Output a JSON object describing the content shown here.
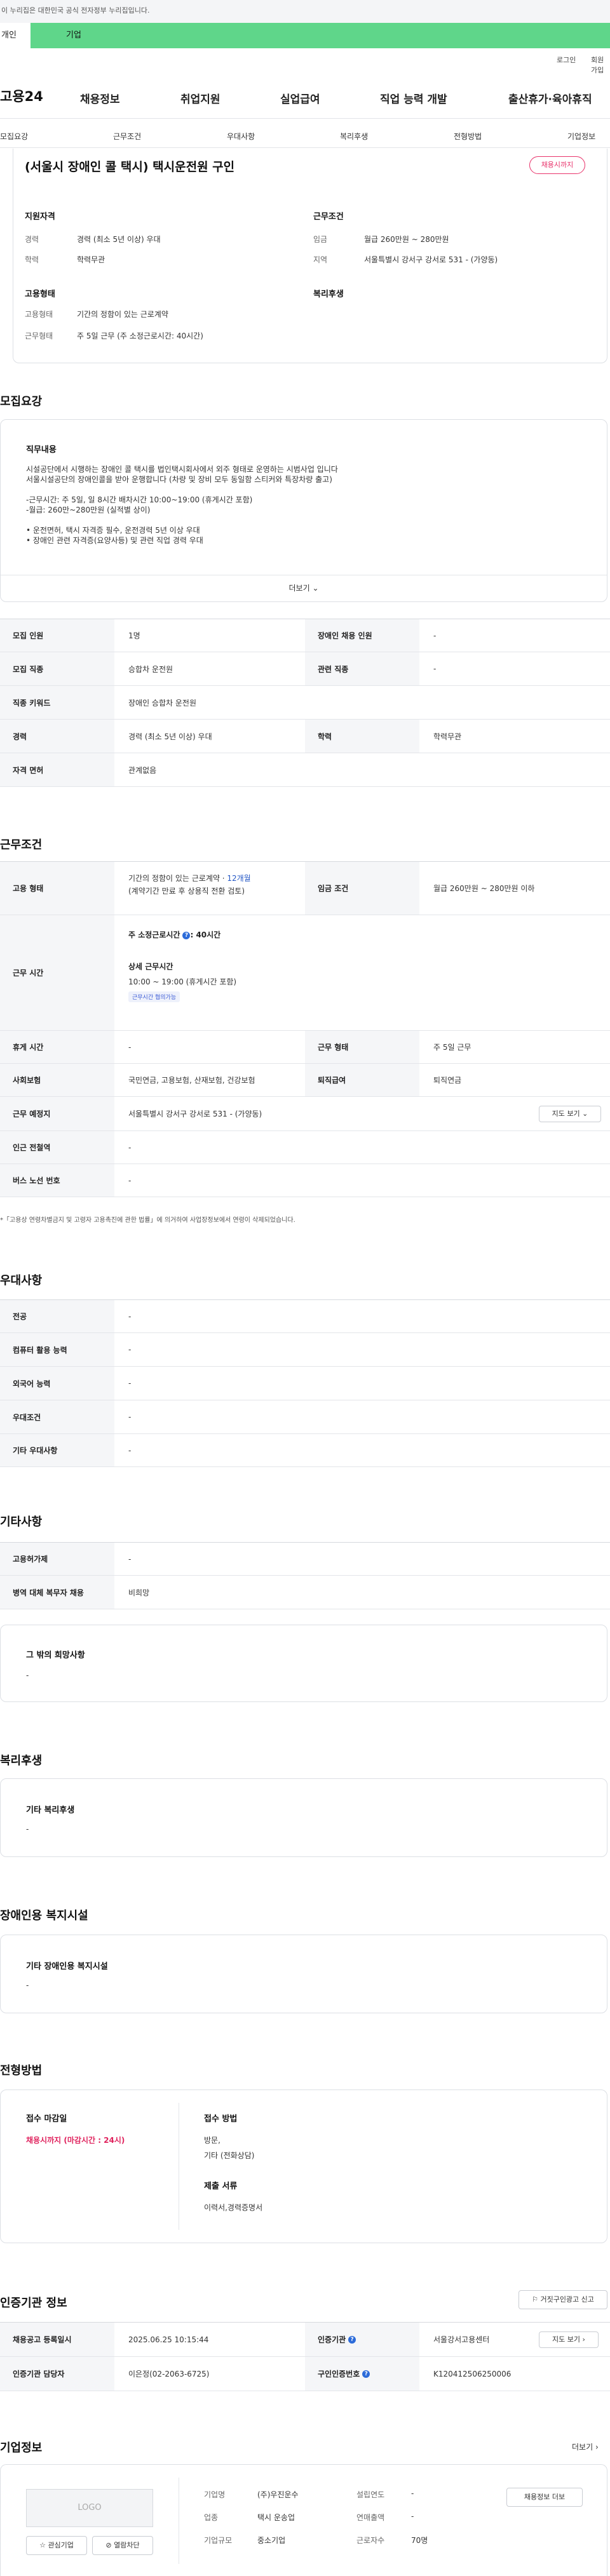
{
  "gov_banner": "이 누리집은 대한민국 공식 전자정부 누리집입니다.",
  "tabs": {
    "personal": "개인",
    "company": "기업"
  },
  "util": {
    "login": "로그인",
    "signup": "회원가입"
  },
  "logo": "고용24",
  "gnb": [
    "채용정보",
    "취업지원",
    "실업급여",
    "직업 능력 개발",
    "출산휴가·육아휴직"
  ],
  "subnav": [
    "모집요강",
    "근무조건",
    "우대사항",
    "복리후생",
    "전형방법",
    "기업정보"
  ],
  "summary": {
    "title": "(서울시 장애인 콜 택시) 택시운전원 구인",
    "badge": "채용시까지",
    "qual_title": "지원자격",
    "career_label": "경력",
    "career_value": "경력 (최소 5년 이상) 우대",
    "edu_label": "학력",
    "edu_value": "학력무관",
    "cond_title": "근무조건",
    "wage_label": "임금",
    "wage_value": "월급 260만원 ~ 280만원",
    "region_label": "지역",
    "region_value": "서울특별시 강서구 강서로 531 - (가양동)",
    "emp_title": "고용형태",
    "emp_type_label": "고용형태",
    "emp_type_value": "기간의 정함이 있는 근로계약",
    "work_label": "근무형태",
    "work_value": "주 5일 근무 (주 소정근로시간: 40시간)",
    "welfare_title": "복리후생"
  },
  "recruit": {
    "title": "모집요강",
    "duty_title": "직무내용",
    "duty_lines": [
      "시설공단에서 시행하는 장애인 콜 택시를 법인택시회사에서 외주 형태로 운영하는 시범사업 입니다",
      "서울시설공단의 장애인콜을 받아 운행합니다 (차량 및 장비 모두 동일함 스티커와 특장차량 출고)",
      "",
      "-근무시간: 주 5일, 일 8시간 배차시간 10:00~19:00 (휴게시간 포함)",
      "-월급: 260만~280만원 (실적별 상이)",
      "",
      "• 운전면허, 택시 자격증 필수, 운전경력 5년 이상 우대",
      "• 장애인 관련 자격증(요양사등) 및 관련 직업 경력 우대"
    ],
    "more": "더보기",
    "rows": [
      {
        "l1": "모집 인원",
        "v1": "1명",
        "l2": "장애인 채용 인원",
        "v2": "-"
      },
      {
        "l1": "모집 직종",
        "v1": "승합차 운전원",
        "l2": "관련 직종",
        "v2": "-"
      },
      {
        "l1": "직종 키워드",
        "v1": "장애인 승합차 운전원"
      },
      {
        "l1": "경력",
        "v1": "경력 (최소 5년 이상) 우대",
        "l2": "학력",
        "v2": "학력무관"
      },
      {
        "l1": "자격 면허",
        "v1": "관계없음"
      }
    ]
  },
  "conditions": {
    "title": "근무조건",
    "emp_label": "고용 형태",
    "emp_line1": "기간의 정함이 있는 근로계약 · ",
    "emp_months": "12개월",
    "emp_line2": "(계약기간 만료 후 상용직 전환 검토)",
    "wage_label": "임금 조건",
    "wage_value": "월급 260만원 ~ 280만원 이하",
    "hours_label": "근무 시간",
    "hours_main": "주 소정근로시간",
    "hours_num": ": 40시간",
    "detail_title": "상세 근무시간",
    "detail_value": "10:00 ~ 19:00 (휴게시간 포함)",
    "chip": "근무시간 협의가능",
    "rest_label": "휴게 시간",
    "rest_value": "-",
    "shift_label": "근무 형태",
    "shift_value": "주 5일 근무",
    "ins_label": "사회보험",
    "ins_value": "국민연금, 고용보험, 산재보험, 건강보험",
    "sev_label": "퇴직급여",
    "sev_value": "퇴직연금",
    "place_label": "근무 예정지",
    "place_value": "서울특별시 강서구 강서로 531 - (가양동)",
    "map_btn": "지도 보기",
    "station_label": "인근 전철역",
    "station_value": "-",
    "bus_label": "버스 노선 번호",
    "bus_value": "-",
    "note": "*「고용상 연령차별금지 및 고령자 고용촉진에 관한 법률」에 의거하여 사업장정보에서 연령이 삭제되었습니다."
  },
  "pref": {
    "title": "우대사항",
    "rows": [
      {
        "l": "전공",
        "v": "-"
      },
      {
        "l": "컴퓨터 활용 능력",
        "v": "-"
      },
      {
        "l": "외국어 능력",
        "v": "-"
      },
      {
        "l": "우대조건",
        "v": "-"
      },
      {
        "l": "기타 우대사항",
        "v": "-"
      }
    ]
  },
  "other": {
    "title": "기타사항",
    "rows": [
      {
        "l": "고용허가제",
        "v": "-"
      },
      {
        "l": "병역 대체 복무자 채용",
        "v": "비희망"
      }
    ],
    "extra_title": "그 밖의 희망사항",
    "extra_value": "-"
  },
  "welfare": {
    "title": "복리후생",
    "box_title": "기타 복리후생",
    "box_value": "-"
  },
  "facility": {
    "title": "장애인용 복지시설",
    "box_title": "기타 장애인용 복지시설",
    "box_value": "-"
  },
  "process": {
    "title": "전형방법",
    "deadline_label": "접수 마감일",
    "deadline_value": "채용시까지 (마감시간 : 24시)",
    "method_label": "접수 방법",
    "method_v1": "방문,",
    "method_v2": "기타 (전화상담)",
    "docs_label": "제출 서류",
    "docs_value": "이력서,경력증명서"
  },
  "agency": {
    "title": "인증기관 정보",
    "report_btn": "거짓구인광고 신고",
    "date_label": "채용공고 등록일시",
    "date_value": "2025.06.25 10:15:44",
    "org_label": "인증기관",
    "org_value": "서울강서고용센터",
    "map_btn": "지도 보기",
    "mgr_label": "인증기관 담당자",
    "mgr_value": "이은정(02-2063-6725)",
    "id_label": "구인인증번호",
    "id_value": "K120412506250006"
  },
  "company": {
    "title": "기업정보",
    "more": "더보기",
    "logo": "LOGO",
    "fav": "관심기업",
    "block": "열람차단",
    "name_label": "기업명",
    "name_value": "(주)우진운수",
    "year_label": "설립연도",
    "year_value": "-",
    "ind_label": "업종",
    "ind_value": "택시 운송업",
    "sales_label": "연매출액",
    "sales_value": "-",
    "size_label": "기업규모",
    "size_value": "중소기업",
    "emp_label": "근로자수",
    "emp_value": "70명",
    "jobs_btn": "채용정보 더보"
  }
}
